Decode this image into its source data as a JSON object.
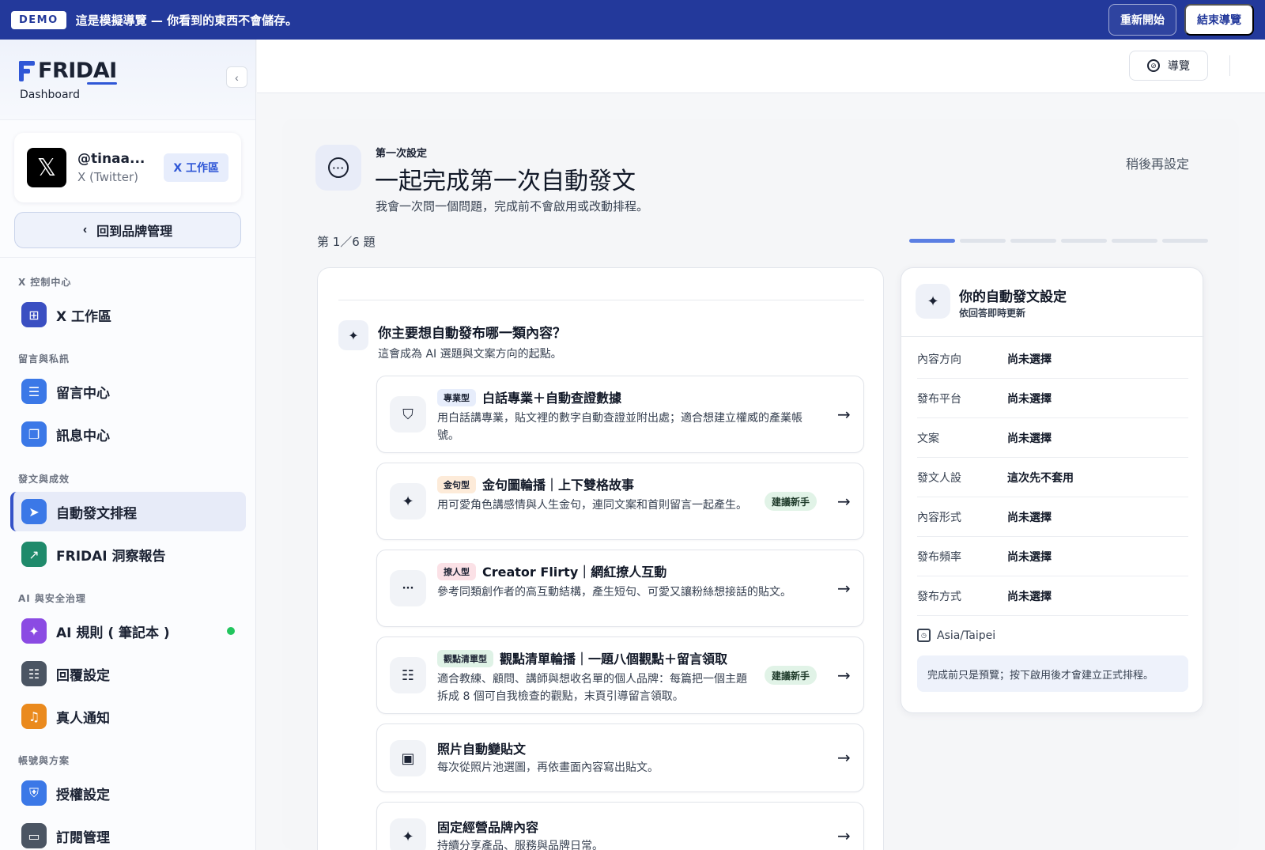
{
  "banner": {
    "badge": "DEMO",
    "text": "這是模擬導覽 — 你看到的東西不會儲存。",
    "restart_label": "重新開始",
    "end_label": "結束導覽"
  },
  "sidebar": {
    "logo_text": "FRIDAI",
    "logo_sub": "Dashboard",
    "collapse_glyph": "‹",
    "account": {
      "logo_glyph": "𝕏",
      "handle": "@tinaa...",
      "platform": "X (Twitter)",
      "badge": "X 工作區"
    },
    "back_label": "回到品牌管理",
    "back_glyph": "‹",
    "groups": [
      {
        "title": "X 控制中心",
        "items": [
          {
            "label": "X 工作區",
            "icon": "grid-icon",
            "glyph": "⊞",
            "color": "#3a4fc2"
          }
        ]
      },
      {
        "title": "留言與私訊",
        "items": [
          {
            "label": "留言中心",
            "icon": "comment-icon",
            "glyph": "☰",
            "color": "#3b78e7"
          },
          {
            "label": "訊息中心",
            "icon": "chat-icon",
            "glyph": "❐",
            "color": "#3b78e7"
          }
        ]
      },
      {
        "title": "發文與成效",
        "items": [
          {
            "label": "自動發文排程",
            "icon": "send-icon",
            "glyph": "➤",
            "color": "#3b78e7",
            "active": true
          },
          {
            "label": "FRIDAI 洞察報告",
            "icon": "trend-icon",
            "glyph": "↗",
            "color": "#1f8a6b"
          }
        ]
      },
      {
        "title": "AI 與安全治理",
        "items": [
          {
            "label": "AI 規則 ( 筆記本 )",
            "icon": "sparkle-icon",
            "glyph": "✦",
            "color": "#8b4be3",
            "status": true
          },
          {
            "label": "回覆設定",
            "icon": "sliders-icon",
            "glyph": "☷",
            "color": "#4b5563"
          },
          {
            "label": "真人通知",
            "icon": "bell-icon",
            "glyph": "♫",
            "color": "#ea8a1e"
          }
        ]
      },
      {
        "title": "帳號與方案",
        "items": [
          {
            "label": "授權設定",
            "icon": "shield-icon",
            "glyph": "⛨",
            "color": "#3b78e7"
          },
          {
            "label": "訂閱管理",
            "icon": "card-icon",
            "glyph": "▭",
            "color": "#4b5563"
          }
        ]
      }
    ]
  },
  "topbar": {
    "guide_label": "導覽",
    "guide_glyph": "⊘"
  },
  "wizard": {
    "eyebrow": "第一次設定",
    "title": "一起完成第一次自動發文",
    "description": "我會一次問一個問題，完成前不會啟用或改動排程。",
    "later_label": "稍後再設定",
    "step_label": "第 1／6 題",
    "progress": {
      "current": 1,
      "total": 6
    },
    "question": {
      "title": "你主要想自動發布哪一類內容？",
      "subtitle": "這會成為 AI 選題與文案方向的起點。"
    },
    "options": [
      {
        "icon": "shield-check-icon",
        "glyph": "⛉",
        "tag": "專業型",
        "tag_style": "tag-blue",
        "title": "白話專業＋自動查證數據",
        "desc": "用白話講專業，貼文裡的數字自動查證並附出處；適合想建立權威的產業帳號。",
        "recommended": ""
      },
      {
        "icon": "sparkle-icon",
        "glyph": "✦",
        "tag": "金句型",
        "tag_style": "tag-orange",
        "title": "金句圖輪播｜上下雙格故事",
        "desc": "用可愛角色講感情與人生金句，連同文案和首則留言一起產生。",
        "recommended": "建議新手"
      },
      {
        "icon": "chat-bubble-icon",
        "glyph": "···",
        "tag": "撩人型",
        "tag_style": "tag-pink",
        "title": "Creator Flirty｜網紅撩人互動",
        "desc": "參考同類創作者的高互動結構，產生短句、可愛又讓粉絲想接話的貼文。",
        "recommended": ""
      },
      {
        "icon": "checklist-icon",
        "glyph": "☷",
        "tag": "觀點清單型",
        "tag_style": "tag-green",
        "title": "觀點清單輪播｜一題八個觀點＋留言領取",
        "desc": "適合教練、顧問、講師與想收名單的個人品牌：每篇把一個主題拆成 8 個可自我檢查的觀點，末頁引導留言領取。",
        "recommended": "建議新手"
      },
      {
        "icon": "photo-icon",
        "glyph": "▣",
        "tag": "",
        "tag_style": "",
        "title": "照片自動變貼文",
        "desc": "每次從照片池選圖，再依畫面內容寫出貼文。",
        "recommended": ""
      },
      {
        "icon": "sparkle-icon",
        "glyph": "✦",
        "tag": "",
        "tag_style": "",
        "title": "固定經營品牌內容",
        "desc": "持續分享產品、服務與品牌日常。",
        "recommended": ""
      }
    ],
    "arrow_glyph": "→"
  },
  "summary": {
    "title": "你的自動發文設定",
    "subtitle": "依回答即時更新",
    "rows": [
      {
        "key": "內容方向",
        "value": "尚未選擇"
      },
      {
        "key": "發布平台",
        "value": "尚未選擇"
      },
      {
        "key": "文案",
        "value": "尚未選擇"
      },
      {
        "key": "發文人設",
        "value": "這次先不套用"
      },
      {
        "key": "內容形式",
        "value": "尚未選擇"
      },
      {
        "key": "發布頻率",
        "value": "尚未選擇"
      },
      {
        "key": "發布方式",
        "value": "尚未選擇"
      }
    ],
    "timezone": "Asia/Taipei",
    "note": "完成前只是預覽；按下啟用後才會建立正式排程。"
  }
}
